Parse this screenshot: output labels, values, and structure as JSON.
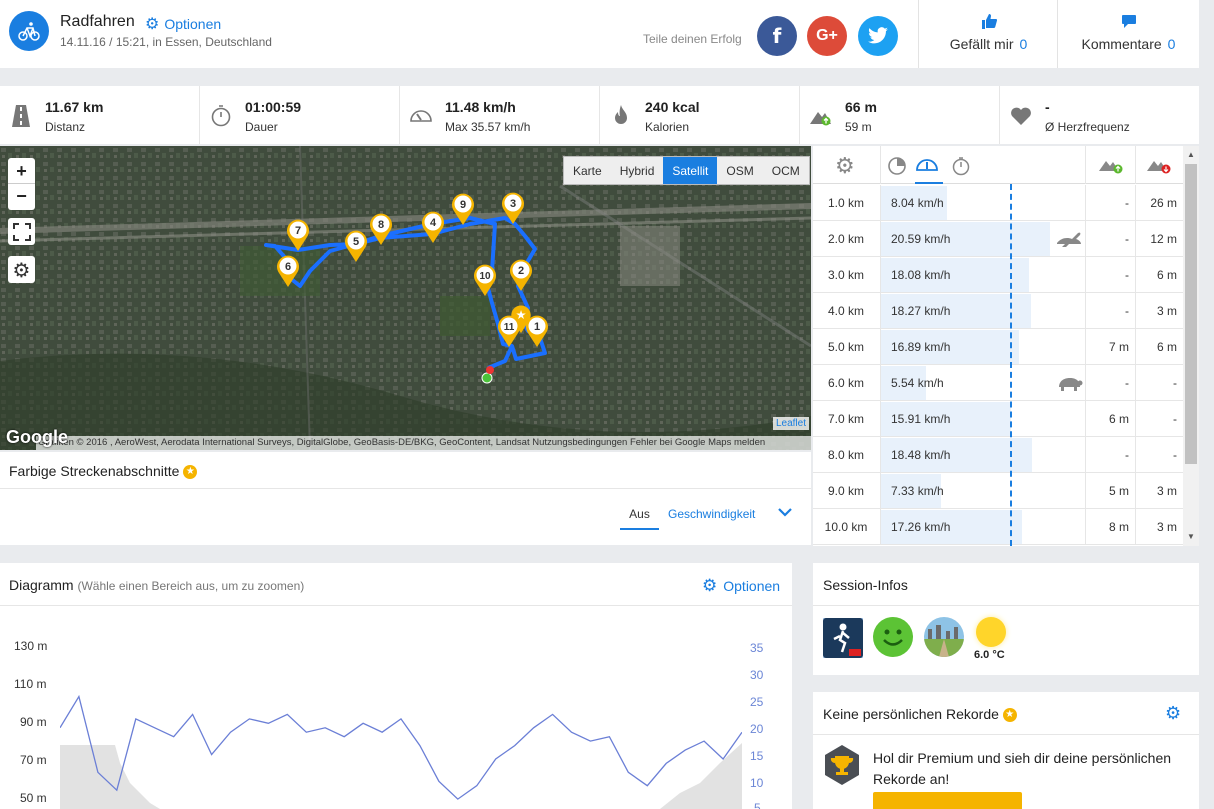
{
  "header": {
    "title": "Radfahren",
    "options_label": "Optionen",
    "subtitle": "14.11.16 / 15:21, in Essen, Deutschland",
    "share_text": "Teile deinen Erfolg",
    "social": {
      "facebook": "f",
      "google": "G+",
      "twitter": "t"
    },
    "like_label": "Gefällt mir",
    "like_count": "0",
    "comment_label": "Kommentare",
    "comment_count": "0"
  },
  "stats": [
    {
      "icon": "road-icon",
      "value": "11.67 km",
      "label": "Distanz"
    },
    {
      "icon": "stopwatch-icon",
      "value": "01:00:59",
      "label": "Dauer"
    },
    {
      "icon": "speedometer-icon",
      "value": "11.48 km/h",
      "label": "Max 35.57 km/h"
    },
    {
      "icon": "flame-icon",
      "value": "240 kcal",
      "label": "Kalorien"
    },
    {
      "icon": "elevation-up-icon",
      "value": "66 m",
      "label": "59 m"
    },
    {
      "icon": "heart-icon",
      "value": "-",
      "label": "Ø Herzfrequenz"
    }
  ],
  "map": {
    "zoom_in": "+",
    "zoom_out": "−",
    "layers": [
      "Karte",
      "Hybrid",
      "Satellit",
      "OSM",
      "OCM"
    ],
    "active_layer": "Satellit",
    "attribution": "Grafiken © 2016 , AeroWest, Aerodata International Surveys, DigitalGlobe, GeoBasis-DE/BKG, GeoContent, Landsat     Nutzungsbedingungen     Fehler bei Google Maps melden",
    "google": "Google",
    "leaflet": "Leaflet",
    "markers": [
      "1",
      "2",
      "3",
      "4",
      "5",
      "6",
      "7",
      "8",
      "9",
      "10",
      "11"
    ]
  },
  "segments": {
    "title": "Farbige Streckenabschnitte",
    "tab_off": "Aus",
    "tab_speed": "Geschwindigkeit"
  },
  "splits": {
    "rows": [
      {
        "km": "1.0 km",
        "speed": "8.04 km/h",
        "up": "-",
        "down": "26 m",
        "speed_value": 8.04
      },
      {
        "km": "2.0 km",
        "speed": "20.59 km/h",
        "up": "-",
        "down": "12 m",
        "speed_value": 20.59,
        "marker": "hare-icon"
      },
      {
        "km": "3.0 km",
        "speed": "18.08 km/h",
        "up": "-",
        "down": "6 m",
        "speed_value": 18.08
      },
      {
        "km": "4.0 km",
        "speed": "18.27 km/h",
        "up": "-",
        "down": "3 m",
        "speed_value": 18.27
      },
      {
        "km": "5.0 km",
        "speed": "16.89 km/h",
        "up": "7 m",
        "down": "6 m",
        "speed_value": 16.89
      },
      {
        "km": "6.0 km",
        "speed": "5.54 km/h",
        "up": "-",
        "down": "-",
        "speed_value": 5.54,
        "marker": "turtle-icon"
      },
      {
        "km": "7.0 km",
        "speed": "15.91 km/h",
        "up": "6 m",
        "down": "-",
        "speed_value": 15.91
      },
      {
        "km": "8.0 km",
        "speed": "18.48 km/h",
        "up": "-",
        "down": "-",
        "speed_value": 18.48
      },
      {
        "km": "9.0 km",
        "speed": "7.33 km/h",
        "up": "5 m",
        "down": "3 m",
        "speed_value": 7.33
      },
      {
        "km": "10.0 km",
        "speed": "17.26 km/h",
        "up": "8 m",
        "down": "3 m",
        "speed_value": 17.26
      }
    ]
  },
  "diagram": {
    "title": "Diagramm",
    "hint": "(Wähle einen Bereich aus, um zu zoomen)",
    "options_label": "Optionen"
  },
  "chart_data": {
    "type": "line",
    "y_left_ticks": [
      "130 m",
      "110 m",
      "90 m",
      "70 m",
      "50 m"
    ],
    "y_right_ticks": [
      "35",
      "30",
      "25",
      "20",
      "15",
      "10",
      "5"
    ],
    "series": [
      {
        "values": [
          18,
          25,
          8,
          4,
          20,
          18,
          16,
          21,
          12,
          17,
          20,
          19,
          21,
          17,
          18,
          16,
          19,
          17,
          20,
          14,
          6,
          2,
          5,
          11,
          14,
          18,
          21,
          17,
          15,
          16,
          8,
          5,
          10,
          13,
          15,
          11,
          17
        ]
      }
    ]
  },
  "session": {
    "title": "Session-Infos",
    "temperature": "6.0 °C"
  },
  "records": {
    "title": "Keine persönlichen Rekorde",
    "text": "Hol dir Premium und sieh dir deine persönlichen Rekorde an!"
  }
}
